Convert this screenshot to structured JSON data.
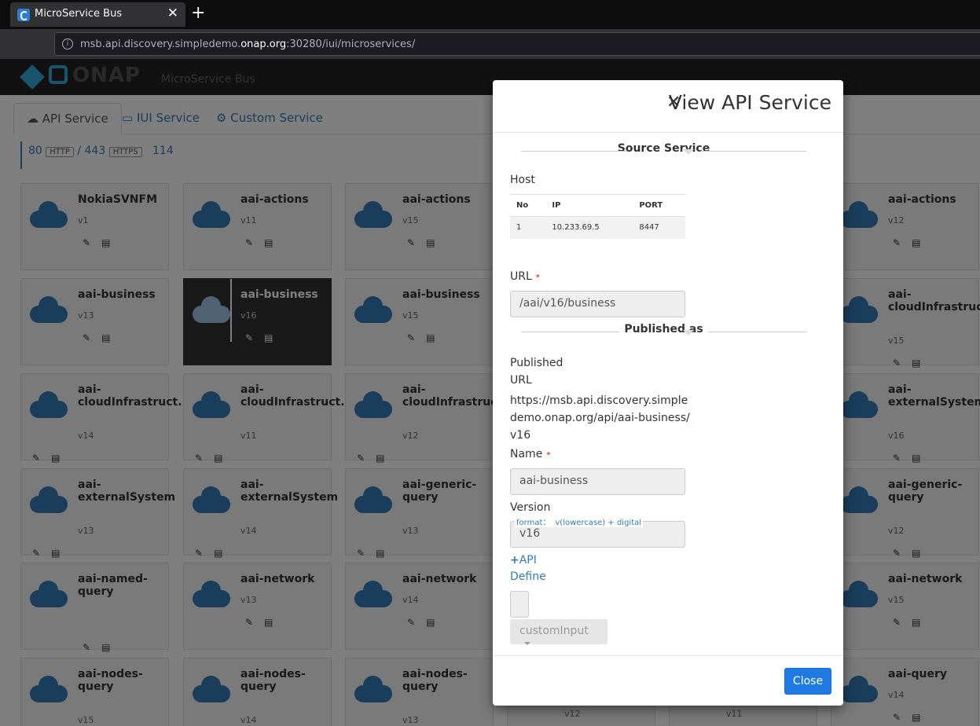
{
  "browser": {
    "tab_title": "MicroService Bus",
    "url_prefix": "msb.api.discovery.simpledemo.",
    "url_highlight": "onap.org",
    "url_suffix": ":30280/iui/microservices/"
  },
  "app": {
    "logo_text": "ONAP",
    "bar_title": "MicroService Bus",
    "tabs": [
      "API Service",
      "IUI Service",
      "Custom Service"
    ],
    "stats": {
      "http_count": "80",
      "http_label": "HTTP",
      "sep": "/",
      "https_count": "443",
      "https_label": "HTTPS",
      "total": "114"
    }
  },
  "cards": [
    {
      "name": "NokiaSVNFM",
      "version": "v1"
    },
    {
      "name": "aai-actions",
      "version": "v11"
    },
    {
      "name": "aai-actions",
      "version": "v15"
    },
    {
      "name": "aai-actions",
      "version": "v12"
    },
    {
      "name": "aai-business",
      "version": "v13"
    },
    {
      "name": "aai-business",
      "version": "v16"
    },
    {
      "name": "aai-business",
      "version": "v15"
    },
    {
      "name": "aai-cloudInfrastruct...",
      "version": "v15"
    },
    {
      "name": "aai-cloudInfrastruct...",
      "version": "v14"
    },
    {
      "name": "aai-cloudInfrastruct...",
      "version": "v11"
    },
    {
      "name": "aai-cloudInfrastruct...",
      "version": "v12"
    },
    {
      "name": "aai-externalSystem",
      "version": "v16"
    },
    {
      "name": "aai-externalSystem",
      "version": "v13"
    },
    {
      "name": "aai-externalSystem",
      "version": "v14"
    },
    {
      "name": "aai-generic-query",
      "version": "v13"
    },
    {
      "name": "aai-generic-query",
      "version": "v12"
    },
    {
      "name": "aai-named-query",
      "version": ""
    },
    {
      "name": "aai-network",
      "version": "v13"
    },
    {
      "name": "aai-network",
      "version": "v14"
    },
    {
      "name": "aai-network",
      "version": "v15"
    },
    {
      "name": "aai-nodes-query",
      "version": "v15"
    },
    {
      "name": "aai-nodes-query",
      "version": "v14"
    },
    {
      "name": "aai-nodes-query",
      "version": "v13"
    },
    {
      "name": "aai-query",
      "version": "v14"
    }
  ],
  "hidden_versions": [
    "v12",
    "v11"
  ],
  "modal": {
    "title": "View API Service",
    "source_section": "Source Service",
    "host_label": "Host",
    "host_table": {
      "headers": [
        "No",
        "IP",
        "PORT"
      ],
      "rows": [
        [
          "1",
          "10.233.69.5",
          "8447"
        ]
      ]
    },
    "url_label": "URL",
    "url_required": "*",
    "url_value": "/aai/v16/business",
    "published_section": "Published as",
    "published_url_label_1": "Published",
    "published_url_label_2": "URL",
    "published_url_value": "https://msb.api.discovery.simpledemo.onap.org/api/aai-business/v16",
    "name_label": "Name",
    "name_required": "*",
    "name_value": "aai-business",
    "version_label": "Version",
    "version_hint_a": "format：",
    "version_hint_b": "v(lowercase) + digital",
    "version_value": "v16",
    "api_define_1": "API",
    "api_define_2": "Define",
    "custom_input": "customInput",
    "close_button": "Close"
  }
}
